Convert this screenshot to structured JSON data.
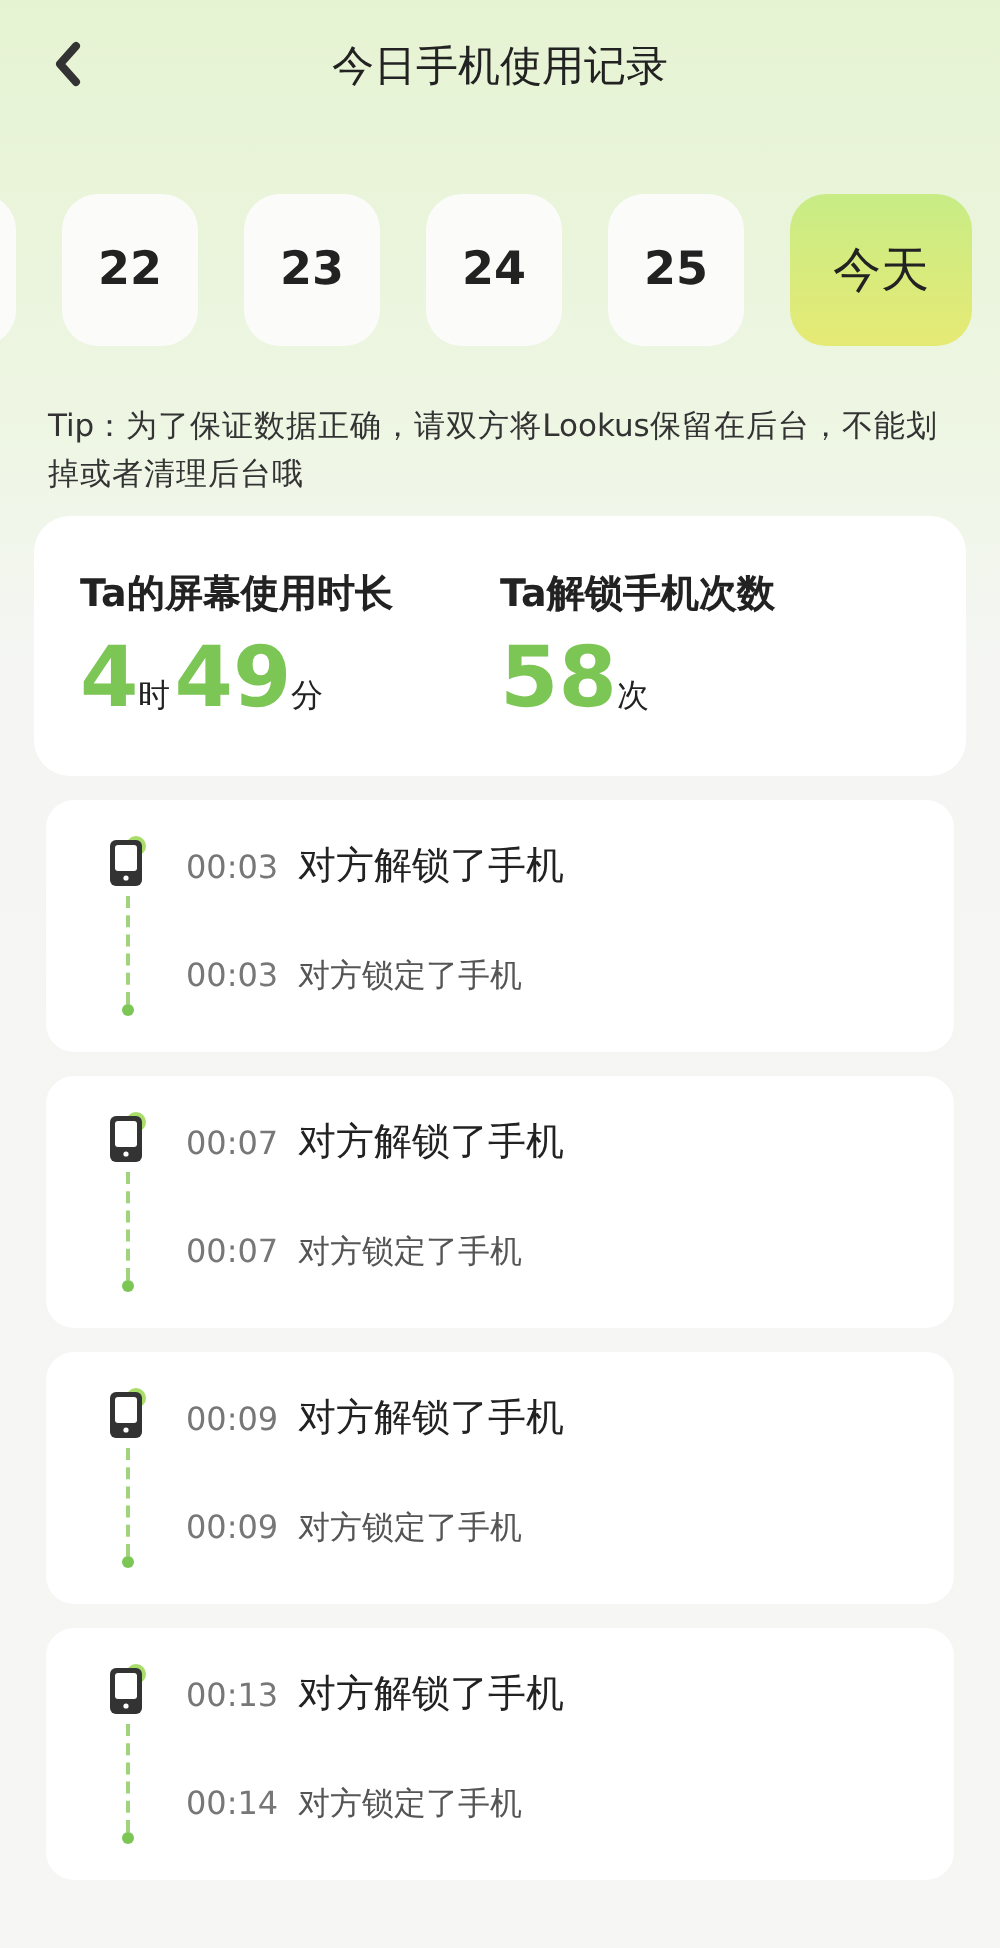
{
  "header": {
    "title": "今日手机使用记录"
  },
  "dates": [
    {
      "label": "22",
      "selected": false
    },
    {
      "label": "23",
      "selected": false
    },
    {
      "label": "24",
      "selected": false
    },
    {
      "label": "25",
      "selected": false
    },
    {
      "label": "今天",
      "selected": true
    }
  ],
  "tip": "Tip：为了保证数据正确，请双方将Lookus保留在后台，不能划掉或者清理后台哦",
  "stats": [
    {
      "label": "Ta的屏幕使用时长",
      "parts": [
        {
          "number": "4",
          "unit": "时"
        },
        {
          "number": "49",
          "unit": "分"
        }
      ]
    },
    {
      "label": "Ta解锁手机次数",
      "parts": [
        {
          "number": "58",
          "unit": "次"
        }
      ]
    }
  ],
  "sessions": [
    {
      "events": [
        {
          "kind": "unlock",
          "time": "00:03",
          "text": "对方解锁了手机"
        },
        {
          "kind": "lock",
          "time": "00:03",
          "text": "对方锁定了手机"
        }
      ]
    },
    {
      "events": [
        {
          "kind": "unlock",
          "time": "00:07",
          "text": "对方解锁了手机"
        },
        {
          "kind": "lock",
          "time": "00:07",
          "text": "对方锁定了手机"
        }
      ]
    },
    {
      "events": [
        {
          "kind": "unlock",
          "time": "00:09",
          "text": "对方解锁了手机"
        },
        {
          "kind": "lock",
          "time": "00:09",
          "text": "对方锁定了手机"
        }
      ]
    },
    {
      "events": [
        {
          "kind": "unlock",
          "time": "00:13",
          "text": "对方解锁了手机"
        },
        {
          "kind": "lock",
          "time": "00:14",
          "text": "对方锁定了手机"
        }
      ]
    }
  ]
}
